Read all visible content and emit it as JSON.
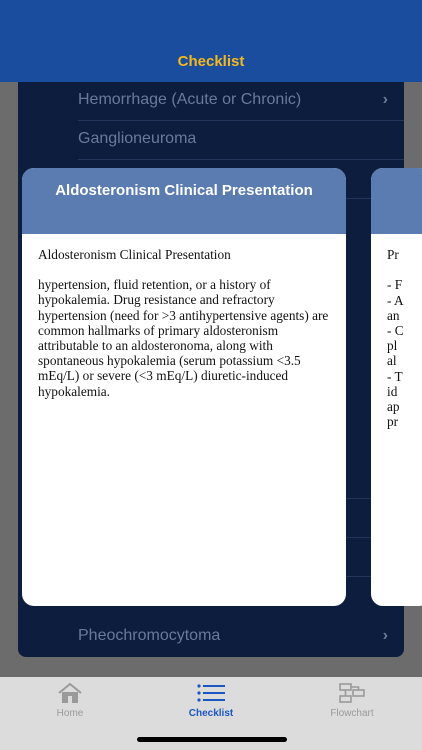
{
  "header": {
    "title": "Checklist"
  },
  "list": {
    "items": [
      {
        "label": "Hemorrhage (Acute or Chronic)",
        "chevron": "›"
      },
      {
        "label": "Ganglioneuroma",
        "chevron": ""
      },
      {
        "label": "Pheochromocytoma",
        "chevron": "›"
      }
    ]
  },
  "card": {
    "title": "Aldosteronism Clinical Presentation",
    "heading": "Aldosteronism Clinical Presentation",
    "body": "hypertension, fluid retention, or a history of hypokalemia. Drug resistance and refractory hypertension (need for >3 antihypertensive agents) are common hallmarks of primary aldosteronism attributable to an aldosteronoma, along with spontaneous hypokalemia (serum potassium <3.5 mEq/L) or severe (<3 mEq/L) diuretic-induced hypokalemia."
  },
  "next_card": {
    "lines": [
      "Pr",
      "",
      "- F",
      "- A",
      "an",
      "- C",
      "pl",
      "al",
      "- T",
      "id",
      "ap",
      "pr"
    ]
  },
  "tabbar": {
    "tabs": [
      {
        "label": "Home",
        "icon": "house-icon",
        "active": false
      },
      {
        "label": "Checklist",
        "icon": "list-icon",
        "active": true
      },
      {
        "label": "Flowchart",
        "icon": "flowchart-icon",
        "active": false
      }
    ]
  },
  "colors": {
    "header": "#1a4d9e",
    "title": "#f4b81e",
    "card_head": "#5a7cb0",
    "active_tab": "#1a56c4"
  }
}
